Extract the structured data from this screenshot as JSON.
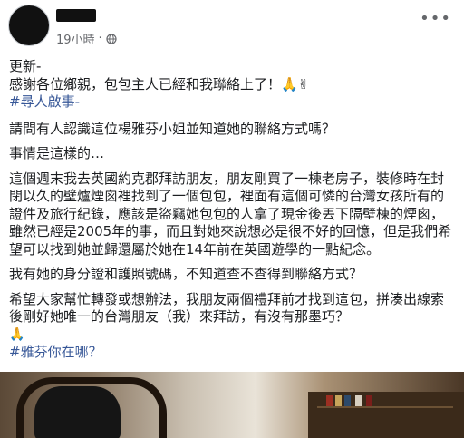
{
  "post": {
    "time": "19小時",
    "privacy_icon": "globe-icon",
    "more_icon": "ellipsis-icon"
  },
  "content": {
    "update_label": "更新-",
    "update_text": "感謝各位鄉親，包包主人已經和我聯絡上了！🙏✌",
    "tag1": "#尋人啟事-",
    "question": "請問有人認識這位楊雅芬小姐並知道她的聯絡方式嗎？",
    "intro": "事情是這樣的…",
    "para1": [
      "這個週末我去英國約克郡拜訪朋友，朋友剛買了一棟老房子，裝修時在封",
      "閉以久的壁爐煙囪裡找到了一個包包，裡面有這個可憐的台灣女孩所有的",
      "證件及旅行紀錄，應該是盜竊她包包的人拿了現金後丟下隔壁棟的煙囪，",
      "雖然已經是2005年的事，而且對她來說想必是很不好的回憶，但是我們希",
      "望可以找到她並歸還屬於她在14年前在英國遊學的一點紀念。"
    ],
    "para2": "我有她的身分證和護照號碼，不知道查不查得到聯絡方式？",
    "para3": [
      "希望大家幫忙轉發或想辦法，我朋友兩個禮拜前才找到這包，拼湊出線索",
      "後剛好她唯一的台灣朋友（我）來拜訪，有沒有那墨巧？"
    ],
    "pray": "🙏",
    "tag2": "#雅芬你在哪？"
  },
  "colors": {
    "text": "#1c1e21",
    "meta": "#65676b",
    "hashtag": "#385898"
  }
}
